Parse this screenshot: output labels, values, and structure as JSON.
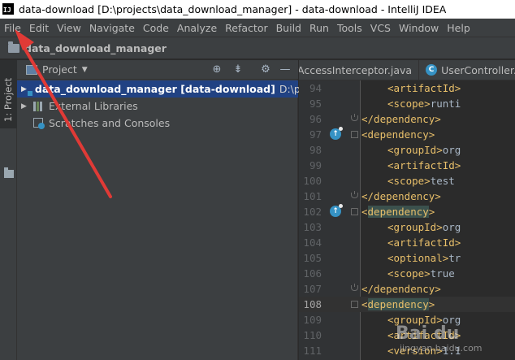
{
  "window": {
    "title": "data-download [D:\\projects\\data_download_manager] - data-download - IntelliJ IDEA",
    "logo_text": "IJ"
  },
  "menubar": {
    "items": [
      "File",
      "Edit",
      "View",
      "Navigate",
      "Code",
      "Analyze",
      "Refactor",
      "Build",
      "Run",
      "Tools",
      "VCS",
      "Window",
      "Help"
    ]
  },
  "navbar": {
    "project": "data_download_manager"
  },
  "stripe": {
    "project_tab": "1: Project"
  },
  "project_panel": {
    "title": "Project",
    "tree": [
      {
        "label": "data_download_manager [data-download]",
        "path": "D:\\proje",
        "expanded": false,
        "selected": true
      },
      {
        "label": "External Libraries",
        "path": "",
        "expanded": false,
        "selected": false
      },
      {
        "label": "Scratches and Consoles",
        "path": "",
        "expanded": false,
        "selected": false
      }
    ]
  },
  "editor": {
    "tabs": [
      {
        "label": "AccessInterceptor.java",
        "icon": ""
      },
      {
        "label": "UserController.",
        "icon": "C"
      }
    ],
    "current_line": 108,
    "lines": [
      {
        "n": 94,
        "indent": 4,
        "tag": "<artifactId>",
        "text": "",
        "fold": ""
      },
      {
        "n": 95,
        "indent": 4,
        "tag": "<scope>",
        "text": "runti",
        "fold": ""
      },
      {
        "n": 96,
        "indent": 2,
        "tag": "</dependency>",
        "text": "",
        "fold": "bot"
      },
      {
        "n": 97,
        "indent": 2,
        "tag": "<dependency>",
        "text": "",
        "fold": "top",
        "marker": true
      },
      {
        "n": 98,
        "indent": 4,
        "tag": "<groupId>",
        "text": "org",
        "fold": ""
      },
      {
        "n": 99,
        "indent": 4,
        "tag": "<artifactId>",
        "text": "",
        "fold": ""
      },
      {
        "n": 100,
        "indent": 4,
        "tag": "<scope>",
        "text": "test",
        "fold": ""
      },
      {
        "n": 101,
        "indent": 2,
        "tag": "</dependency>",
        "text": "",
        "fold": "bot"
      },
      {
        "n": 102,
        "indent": 2,
        "tag": "<dependency>",
        "text": "",
        "fold": "top",
        "marker": true,
        "highlight": true
      },
      {
        "n": 103,
        "indent": 4,
        "tag": "<groupId>",
        "text": "org",
        "fold": ""
      },
      {
        "n": 104,
        "indent": 4,
        "tag": "<artifactId>",
        "text": "",
        "fold": ""
      },
      {
        "n": 105,
        "indent": 4,
        "tag": "<optional>",
        "text": "tr",
        "fold": ""
      },
      {
        "n": 106,
        "indent": 4,
        "tag": "<scope>",
        "text": "true",
        "fold": ""
      },
      {
        "n": 107,
        "indent": 2,
        "tag": "</dependency>",
        "text": "",
        "fold": "bot"
      },
      {
        "n": 108,
        "indent": 2,
        "tag": "<dependency>",
        "text": "",
        "fold": "top",
        "highlight": true
      },
      {
        "n": 109,
        "indent": 4,
        "tag": "<groupId>",
        "text": "org",
        "fold": ""
      },
      {
        "n": 110,
        "indent": 4,
        "tag": "<artifactId>",
        "text": "",
        "fold": ""
      },
      {
        "n": 111,
        "indent": 4,
        "tag": "<version>",
        "text": "1.1",
        "fold": ""
      }
    ]
  },
  "watermark": {
    "brand": "Bai du",
    "site": "jingyan.baidu.com"
  },
  "colors": {
    "annotation_arrow": "#e03a36",
    "xml_tag": "#e8bf6a",
    "selection": "#214283"
  }
}
